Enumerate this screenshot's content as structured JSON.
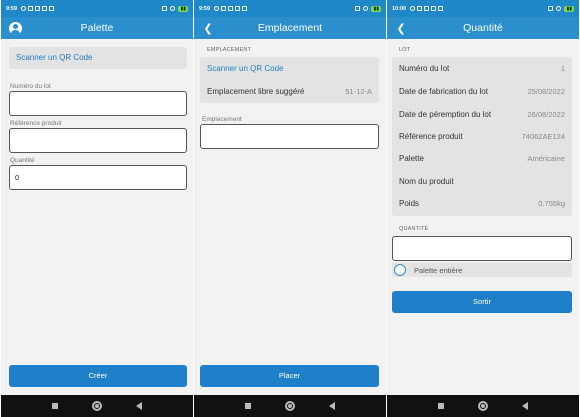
{
  "screens": [
    {
      "status": {
        "time": "9:59"
      },
      "title": "Palette",
      "scan_label": "Scanner un QR Code",
      "lot_label": "Numéro du lot",
      "lot_value": "",
      "ref_label": "Référence produit",
      "ref_value": "",
      "qty_label": "Quantité",
      "qty_value": "0",
      "button": "Créer"
    },
    {
      "status": {
        "time": "9:59"
      },
      "title": "Emplacement",
      "section": "EMPLACEMENT",
      "scan_label": "Scanner un QR Code",
      "suggested_label": "Emplacement libre suggéré",
      "suggested_value": "51-12-A",
      "field_label": "Emplacement",
      "field_value": "",
      "button": "Placer"
    },
    {
      "status": {
        "time": "10:00"
      },
      "title": "Quantité",
      "section": "LOT",
      "rows": [
        {
          "label": "Numéro du lot",
          "value": "1"
        },
        {
          "label": "Date de fabrication du lot",
          "value": "25/08/2022"
        },
        {
          "label": "Date de péremption du lot",
          "value": "26/08/2022"
        },
        {
          "label": "Référence produit",
          "value": "74062AE124"
        },
        {
          "label": "Palette",
          "value": "Américaine"
        },
        {
          "label": "Nom du produit",
          "value": ""
        },
        {
          "label": "Poids",
          "value": "0.755kg"
        }
      ],
      "qty_section": "QUANTITÉ",
      "qty_value": "",
      "radio_label": "Palette entière",
      "button": "Sortir"
    }
  ]
}
